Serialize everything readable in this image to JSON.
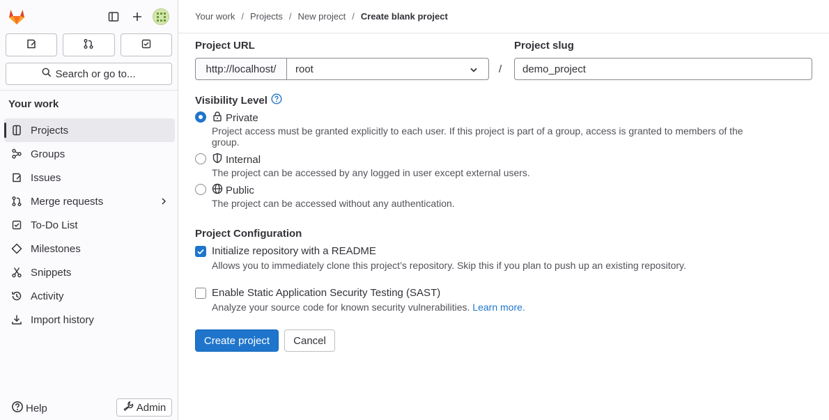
{
  "colors": {
    "accent": "#1f75cb",
    "logo_orange": "#e24329",
    "sidebar_bg": "#fbfafd"
  },
  "sidebar": {
    "search_label": "Search or go to...",
    "section_title": "Your work",
    "items": [
      {
        "label": "Projects",
        "icon": "project-icon",
        "active": true
      },
      {
        "label": "Groups",
        "icon": "group-icon"
      },
      {
        "label": "Issues",
        "icon": "issues-icon"
      },
      {
        "label": "Merge requests",
        "icon": "merge-request-icon",
        "expandable": true
      },
      {
        "label": "To-Do List",
        "icon": "todo-icon"
      },
      {
        "label": "Milestones",
        "icon": "milestone-icon"
      },
      {
        "label": "Snippets",
        "icon": "snippet-icon"
      },
      {
        "label": "Activity",
        "icon": "history-icon"
      },
      {
        "label": "Import history",
        "icon": "import-icon"
      }
    ],
    "help_label": "Help",
    "admin_label": "Admin"
  },
  "breadcrumb": [
    "Your work",
    "Projects",
    "New project",
    "Create blank project"
  ],
  "form": {
    "project_url_label": "Project URL",
    "url_prefix": "http://localhost/",
    "namespace": "root",
    "slash": "/",
    "project_slug_label": "Project slug",
    "project_slug_value": "demo_project",
    "visibility_title": "Visibility Level",
    "visibility_options": [
      {
        "label": "Private",
        "icon": "lock-icon",
        "selected": true,
        "desc": "Project access must be granted explicitly to each user. If this project is part of a group, access is granted to members of the",
        "desc2": "group."
      },
      {
        "label": "Internal",
        "icon": "shield-icon",
        "selected": false,
        "desc": "The project can be accessed by any logged in user except external users."
      },
      {
        "label": "Public",
        "icon": "globe-icon",
        "selected": false,
        "desc": "The project can be accessed without any authentication."
      }
    ],
    "config_title": "Project Configuration",
    "readme_label": "Initialize repository with a README",
    "readme_checked": true,
    "readme_desc": "Allows you to immediately clone this project’s repository. Skip this if you plan to push up an existing repository.",
    "sast_label": "Enable Static Application Security Testing (SAST)",
    "sast_checked": false,
    "sast_desc": "Analyze your source code for known security vulnerabilities.",
    "sast_link": "Learn more.",
    "create_label": "Create project",
    "cancel_label": "Cancel"
  }
}
